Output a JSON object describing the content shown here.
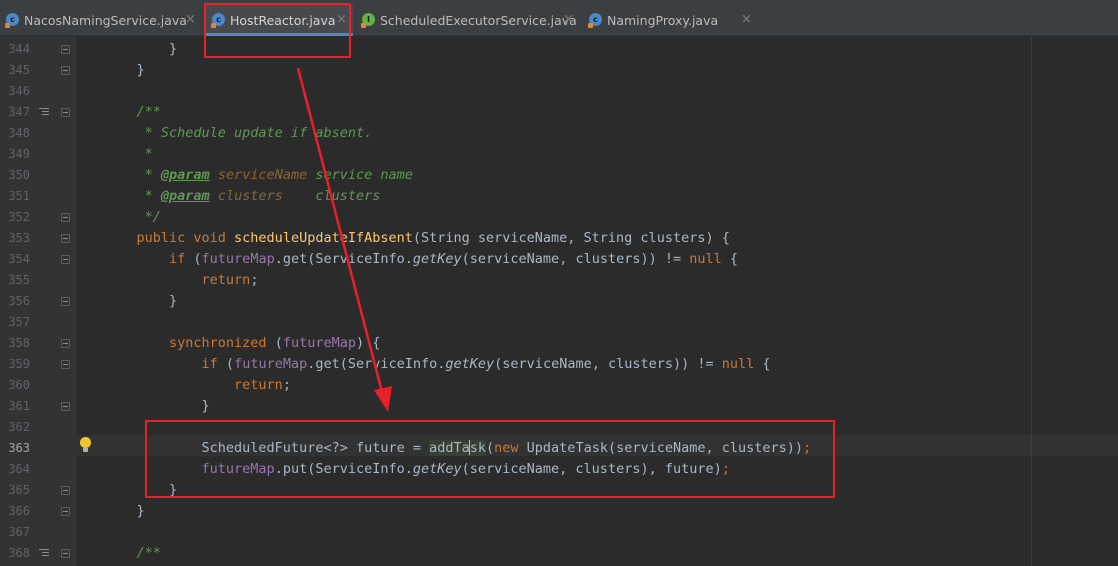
{
  "tabs": [
    {
      "name": "NacosNamingService.java",
      "icon": "class-icon",
      "close": "×"
    },
    {
      "name": "HostReactor.java",
      "icon": "class-icon",
      "close": "×",
      "active": true
    },
    {
      "name": "ScheduledExecutorService.java",
      "icon": "interface-icon",
      "close": "×"
    },
    {
      "name": "NamingProxy.java",
      "icon": "class-icon",
      "close": "×"
    }
  ],
  "editor": {
    "current_line": "363",
    "lines": [
      {
        "n": "344",
        "segs": [
          [
            "",
            "        }"
          ]
        ]
      },
      {
        "n": "345",
        "segs": [
          [
            "",
            "    }"
          ]
        ]
      },
      {
        "n": "346",
        "segs": [
          [
            "",
            ""
          ]
        ]
      },
      {
        "n": "347",
        "segs": [
          [
            "cm",
            "    /**"
          ]
        ]
      },
      {
        "n": "348",
        "segs": [
          [
            "cm",
            "     * Schedule update if absent."
          ]
        ]
      },
      {
        "n": "349",
        "segs": [
          [
            "cm",
            "     *"
          ]
        ]
      },
      {
        "n": "350",
        "segs": [
          [
            "cm",
            "     * "
          ],
          [
            "tg",
            "@param"
          ],
          [
            "cm",
            " "
          ],
          [
            "pn",
            "serviceName"
          ],
          [
            "cm",
            " service name"
          ]
        ]
      },
      {
        "n": "351",
        "segs": [
          [
            "cm",
            "     * "
          ],
          [
            "tg",
            "@param"
          ],
          [
            "cm",
            " "
          ],
          [
            "pn",
            "clusters"
          ],
          [
            "cm",
            "    clusters"
          ]
        ]
      },
      {
        "n": "352",
        "segs": [
          [
            "cm",
            "     */"
          ]
        ]
      },
      {
        "n": "353",
        "segs": [
          [
            "kw",
            "    public void "
          ],
          [
            "fn",
            "scheduleUpdateIfAbsent"
          ],
          [
            "",
            "(String serviceName, String clusters) {"
          ]
        ]
      },
      {
        "n": "354",
        "segs": [
          [
            "kw",
            "        if "
          ],
          [
            "",
            "("
          ],
          [
            "fd",
            "futureMap"
          ],
          [
            "",
            ".get(ServiceInfo."
          ],
          [
            "st",
            "getKey"
          ],
          [
            "",
            "(serviceName, clusters)) != "
          ],
          [
            "kw",
            "null"
          ],
          [
            "",
            " {"
          ]
        ]
      },
      {
        "n": "355",
        "segs": [
          [
            "kw",
            "            return"
          ],
          [
            "",
            ";"
          ]
        ]
      },
      {
        "n": "356",
        "segs": [
          [
            "",
            "        }"
          ]
        ]
      },
      {
        "n": "357",
        "segs": [
          [
            "",
            ""
          ]
        ]
      },
      {
        "n": "358",
        "segs": [
          [
            "kw",
            "        synchronized "
          ],
          [
            "",
            "("
          ],
          [
            "fd",
            "futureMap"
          ],
          [
            "",
            ") {"
          ]
        ]
      },
      {
        "n": "359",
        "segs": [
          [
            "kw",
            "            if "
          ],
          [
            "",
            "("
          ],
          [
            "fd",
            "futureMap"
          ],
          [
            "",
            ".get(ServiceInfo."
          ],
          [
            "st",
            "getKey"
          ],
          [
            "",
            "(serviceName, clusters)) != "
          ],
          [
            "kw",
            "null"
          ],
          [
            "",
            " {"
          ]
        ]
      },
      {
        "n": "360",
        "segs": [
          [
            "kw",
            "                return"
          ],
          [
            "",
            ";"
          ]
        ]
      },
      {
        "n": "361",
        "segs": [
          [
            "",
            "            }"
          ]
        ]
      },
      {
        "n": "362",
        "segs": [
          [
            "",
            ""
          ]
        ]
      },
      {
        "n": "363",
        "segs": [
          [
            "",
            "            ScheduledFuture<?> future = "
          ],
          [
            "hl",
            "addTa"
          ],
          [
            "caret",
            ""
          ],
          [
            "hl",
            "sk"
          ],
          [
            "",
            "("
          ],
          [
            "kw",
            "new "
          ],
          [
            "",
            "UpdateTask(serviceName, clusters))"
          ],
          [
            "kw",
            ";"
          ]
        ]
      },
      {
        "n": "364",
        "segs": [
          [
            "fd",
            "            futureMap"
          ],
          [
            "",
            ".put(ServiceInfo."
          ],
          [
            "st",
            "getKey"
          ],
          [
            "",
            "(serviceName, clusters), future)"
          ],
          [
            "kw",
            ";"
          ]
        ]
      },
      {
        "n": "365",
        "segs": [
          [
            "",
            "        }"
          ]
        ]
      },
      {
        "n": "366",
        "segs": [
          [
            "",
            "    }"
          ]
        ]
      },
      {
        "n": "367",
        "segs": [
          [
            "",
            ""
          ]
        ]
      },
      {
        "n": "368",
        "segs": [
          [
            "cm",
            "    /**"
          ]
        ]
      }
    ]
  },
  "annotation": {
    "color": "#e8202a"
  },
  "colors": {
    "background": "#2b2b2b",
    "keyword": "#cc7832",
    "comment": "#629755",
    "method": "#ffc66d",
    "field": "#9876aa",
    "accent": "#4a88c7"
  }
}
